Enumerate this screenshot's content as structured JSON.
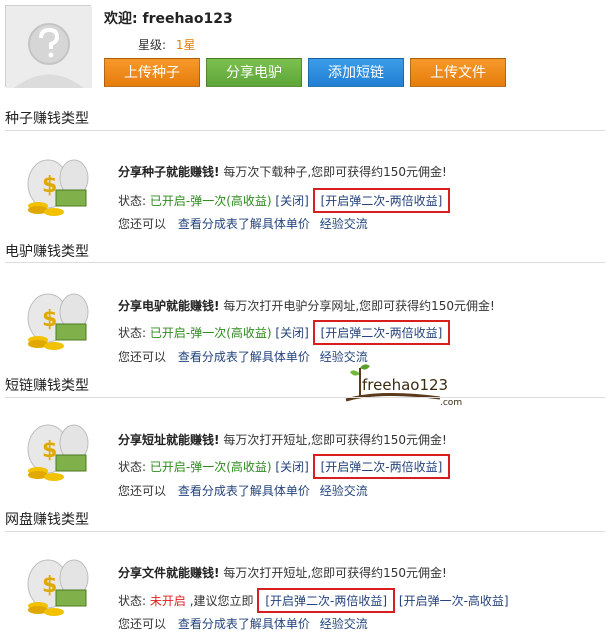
{
  "header": {
    "welcome_label": "欢迎:",
    "username": "freehao123",
    "star_label": "星级:",
    "star_value": "1星"
  },
  "buttons": {
    "upload_seed": "上传种子",
    "share_ed2k": "分享电驴",
    "add_short_link": "添加短链",
    "upload_file": "上传文件"
  },
  "colors": {
    "orange": "#e57c0c",
    "green": "#5ea63a",
    "blue": "#217fd1",
    "active": "#2e8b1e",
    "inactive": "#e02020",
    "highlight_box": "#d81e1e"
  },
  "sections": [
    {
      "title": "种子赚钱类型",
      "headline": "分享种子就能赚钱!",
      "desc": "每万次下载种子,您即可获得约150元佣金!",
      "status_label": "状态:",
      "status_value": "已开启-弹一次(高收益)",
      "close_link": "[关闭]",
      "enable_link": "[开启弹二次-两倍收益]",
      "line3_prefix": "您还可以",
      "table_link": "查看分成表了解具体单价",
      "exchange_link": "经验交流"
    },
    {
      "title": "电驴赚钱类型",
      "headline": "分享电驴就能赚钱!",
      "desc": "每万次打开电驴分享网址,您即可获得约150元佣金!",
      "status_label": "状态:",
      "status_value": "已开启-弹一次(高收益)",
      "close_link": "[关闭]",
      "enable_link": "[开启弹二次-两倍收益]",
      "line3_prefix": "您还可以",
      "table_link": "查看分成表了解具体单价",
      "exchange_link": "经验交流"
    },
    {
      "title": "短链赚钱类型",
      "headline": "分享短址就能赚钱!",
      "desc": "每万次打开短址,您即可获得约150元佣金!",
      "status_label": "状态:",
      "status_value": "已开启-弹一次(高收益)",
      "close_link": "[关闭]",
      "enable_link": "[开启弹二次-两倍收益]",
      "line3_prefix": "您还可以",
      "table_link": "查看分成表了解具体单价",
      "exchange_link": "经验交流"
    },
    {
      "title": "网盘赚钱类型",
      "headline": "分享文件就能赚钱!",
      "desc": "每万次打开短址,您即可获得约150元佣金!",
      "status_label": "状态:",
      "status_value": "未开启",
      "suggest_text": ",建议您立即",
      "enable_link": "[开启弹二次-两倍收益]",
      "enable_once_link": "[开启弹一次-高收益]",
      "line3_prefix": "您还可以",
      "table_link": "查看分成表了解具体单价",
      "exchange_link": "经验交流"
    }
  ],
  "watermark": {
    "text": "freehao123",
    "suffix": ".com"
  }
}
